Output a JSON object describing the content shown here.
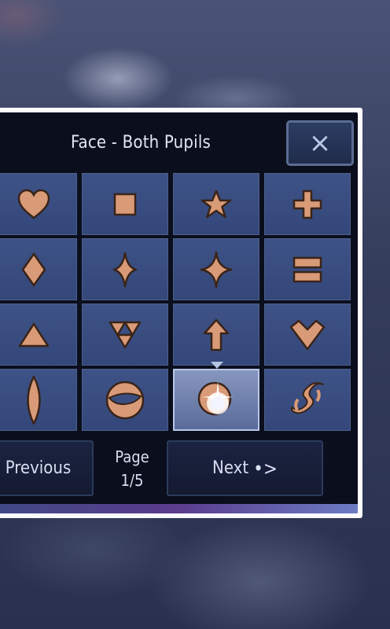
{
  "dialog": {
    "title": "Face - Both Pupils",
    "close_icon": "×"
  },
  "grid": {
    "cells": [
      {
        "name": "heart-icon",
        "selected": false
      },
      {
        "name": "square-icon",
        "selected": false
      },
      {
        "name": "star-icon",
        "selected": false
      },
      {
        "name": "plus-icon",
        "selected": false
      },
      {
        "name": "diamond-icon",
        "selected": false
      },
      {
        "name": "four-point-diamond-icon",
        "selected": false
      },
      {
        "name": "sparkle-icon",
        "selected": false
      },
      {
        "name": "double-bar-icon",
        "selected": false
      },
      {
        "name": "triangle-icon",
        "selected": false
      },
      {
        "name": "triforce-icon",
        "selected": false
      },
      {
        "name": "up-arrow-icon",
        "selected": false
      },
      {
        "name": "heart-chevron-icon",
        "selected": false
      },
      {
        "name": "vertical-oval-icon",
        "selected": false
      },
      {
        "name": "planet-ring-icon",
        "selected": false
      },
      {
        "name": "sparkle-sun-icon",
        "selected": true
      },
      {
        "name": "swirl-s-icon",
        "selected": false
      }
    ]
  },
  "footer": {
    "previous_label": "Previous",
    "page_label": "Page",
    "page_number": "1/5",
    "next_label": "Next",
    "next_icon": "•>"
  },
  "colors": {
    "icon_fill": "#d99a77",
    "icon_stroke": "#3a2418",
    "cell_bg": "#3a4e82",
    "panel_bg": "#0b0e1c"
  }
}
